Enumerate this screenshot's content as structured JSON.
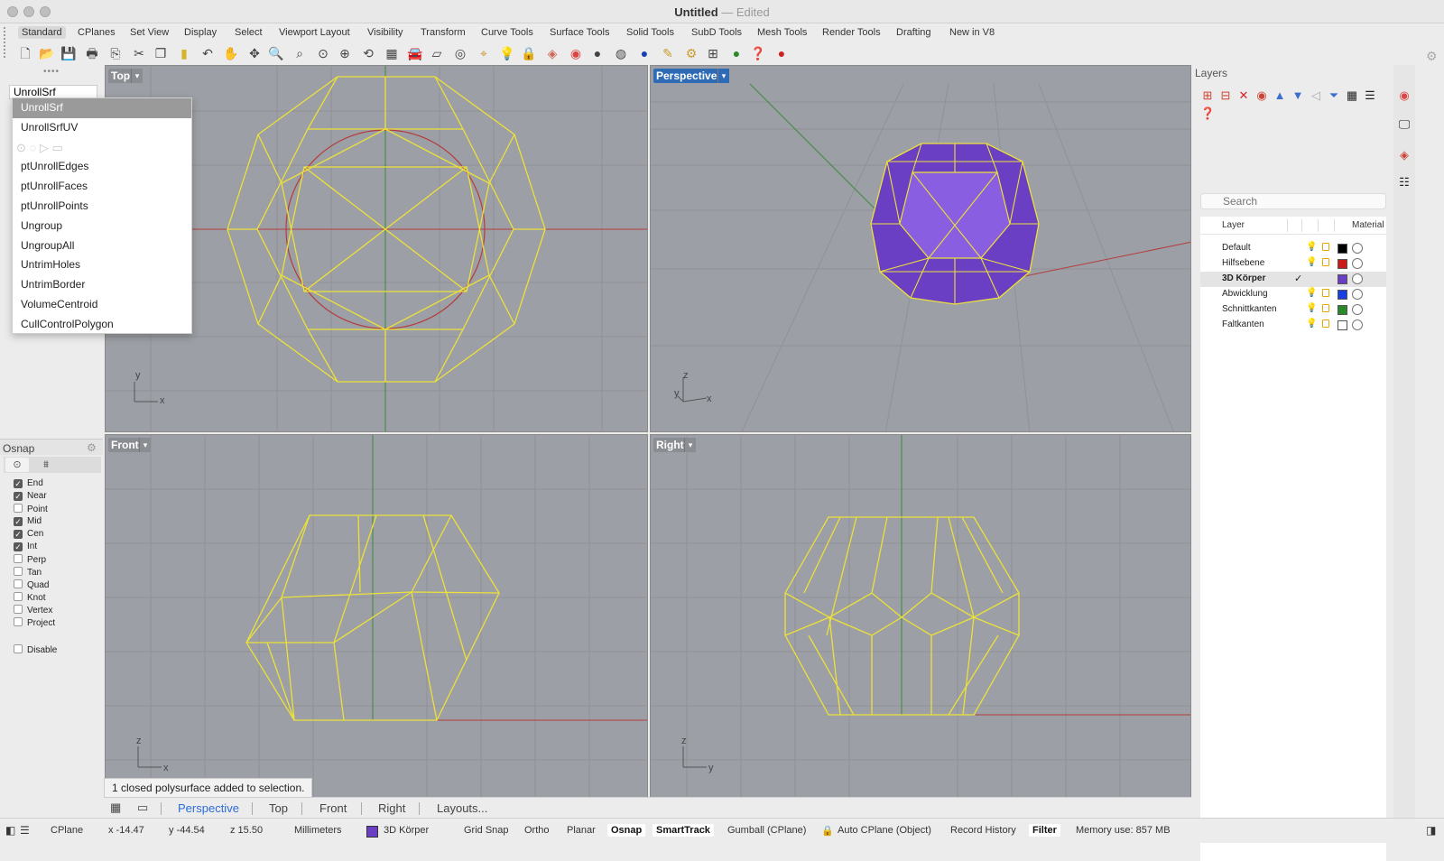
{
  "window": {
    "title": "Untitled",
    "subtitle": "— Edited"
  },
  "ribbon_tabs": [
    "Standard",
    "CPlanes",
    "Set View",
    "Display",
    "Select",
    "Viewport Layout",
    "Visibility",
    "Transform",
    "Curve Tools",
    "Surface Tools",
    "Solid Tools",
    "SubD Tools",
    "Mesh Tools",
    "Render Tools",
    "Drafting",
    "New in V8"
  ],
  "toolbar_icons": [
    "new-file-icon",
    "open-folder-icon",
    "save-icon",
    "print-icon",
    "import-icon",
    "cut-icon",
    "copy-icon",
    "paste-icon",
    "undo-icon",
    "pan-hand-icon",
    "rotate-view-icon",
    "zoom-icon",
    "zoom-window-icon",
    "zoom-extents-icon",
    "zoom-selected-icon",
    "undo-view-icon",
    "four-viewports-icon",
    "car-icon",
    "grid-plane-icon",
    "cplane-icon",
    "named-cplane-icon",
    "light-icon",
    "lock-icon",
    "layer-icon",
    "color-wheel-icon",
    "sphere-shade-icon",
    "rendered-icon",
    "blue-sphere-icon",
    "pen-icon",
    "gear-icon",
    "dimension-icon",
    "globe-icon",
    "help-icon",
    "rhino-icon"
  ],
  "command": {
    "input_value": "UnrollSrf",
    "suggestions": [
      "UnrollSrf",
      "UnrollSrfUV",
      "",
      "ptUnrollEdges",
      "ptUnrollFaces",
      "ptUnrollPoints",
      "Ungroup",
      "UngroupAll",
      "UntrimHoles",
      "UntrimBorder",
      "VolumeCentroid",
      "CullControlPolygon"
    ]
  },
  "osnap": {
    "title": "Osnap",
    "items": [
      {
        "label": "End",
        "checked": true
      },
      {
        "label": "Near",
        "checked": true
      },
      {
        "label": "Point",
        "checked": false
      },
      {
        "label": "Mid",
        "checked": true
      },
      {
        "label": "Cen",
        "checked": true
      },
      {
        "label": "Int",
        "checked": true
      },
      {
        "label": "Perp",
        "checked": false
      },
      {
        "label": "Tan",
        "checked": false
      },
      {
        "label": "Quad",
        "checked": false
      },
      {
        "label": "Knot",
        "checked": false
      },
      {
        "label": "Vertex",
        "checked": false
      },
      {
        "label": "Project",
        "checked": false
      }
    ],
    "disable": {
      "label": "Disable",
      "checked": false
    }
  },
  "viewports": {
    "top": {
      "name": "Top",
      "axis_x": "x",
      "axis_y": "y"
    },
    "perspective": {
      "name": "Perspective",
      "axis_x": "x",
      "axis_y": "y",
      "axis_z": "z"
    },
    "front": {
      "name": "Front",
      "axis_x": "x",
      "axis_z": "z"
    },
    "right": {
      "name": "Right",
      "axis_y": "y",
      "axis_z": "z"
    }
  },
  "layers": {
    "title": "Layers",
    "search_placeholder": "Search",
    "col_layer": "Layer",
    "col_material": "Material",
    "rows": [
      {
        "name": "Default",
        "color": "#000000",
        "current": false
      },
      {
        "name": "Hilfsebene",
        "color": "#cc1a1a",
        "current": false
      },
      {
        "name": "3D Körper",
        "color": "#6a3fc4",
        "current": true
      },
      {
        "name": "Abwicklung",
        "color": "#1a3fe0",
        "current": false
      },
      {
        "name": "Schnittkanten",
        "color": "#2a8a2a",
        "current": false
      },
      {
        "name": "Faltkanten",
        "color": "#ffffff",
        "current": false
      }
    ]
  },
  "viewport_tabs": [
    "Perspective",
    "Top",
    "Front",
    "Right",
    "Layouts..."
  ],
  "toast": "1 closed polysurface added to selection.",
  "status": {
    "cplane": "CPlane",
    "x": "x -14.47",
    "y": "y -44.54",
    "z": "z 15.50",
    "units": "Millimeters",
    "layer": "3D Körper",
    "grid_snap": "Grid Snap",
    "ortho": "Ortho",
    "planar": "Planar",
    "osnap": "Osnap",
    "smarttrack": "SmartTrack",
    "gumball": "Gumball (CPlane)",
    "auto_cplane": "Auto CPlane (Object)",
    "record_history": "Record History",
    "filter": "Filter",
    "memory": "Memory use: 857 MB"
  },
  "colors": {
    "wire": "#ece13a",
    "viewport_bg": "#9c9fa5",
    "active_blue": "#2e6bb4",
    "purple_fill": "#6a3fc4",
    "x_axis": "#b43c3c",
    "y_axis": "#3c8a3c"
  }
}
